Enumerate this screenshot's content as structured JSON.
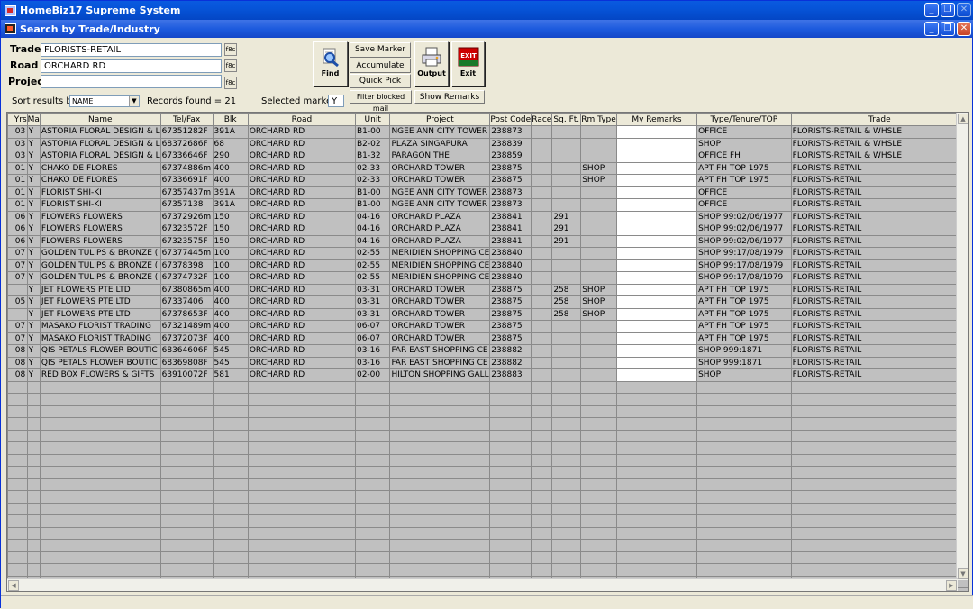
{
  "app_title": "HomeBiz17 Supreme System",
  "window_title": "Search by Trade/Industry",
  "form": {
    "trade_label": "Trade",
    "trade_value": "FLORISTS-RETAIL",
    "road_label": "Road",
    "road_value": "ORCHARD RD",
    "project_label": "Project",
    "project_value": "",
    "lookup_button": "f8c",
    "sort_label": "Sort results by",
    "sort_value": "NAME",
    "records_found": "Records found = 21",
    "selected_marker_label": "Selected marker=",
    "selected_marker_value": "Y"
  },
  "toolbar": {
    "find_label": "Find",
    "save_marker_label": "Save Marker",
    "accumulate_label": "Accumulate",
    "quick_pick_label": "Quick Pick",
    "filter_blocked_label": "Filter blocked mail",
    "show_remarks_label": "Show Remarks",
    "output_label": "Output",
    "exit_label": "Exit",
    "exit_icon_text": "EXIT"
  },
  "grid": {
    "columns": [
      "Yrs",
      "Ma",
      "Name",
      "Tel/Fax",
      "Blk",
      "Road",
      "Unit",
      "Project",
      "Post Code",
      "Race",
      "Sq. Ft.",
      "Rm Type",
      "My Remarks",
      "Type/Tenure/TOP",
      "Trade"
    ],
    "rows": [
      [
        "03",
        "Y",
        "ASTORIA FLORAL DESIGN & L",
        "67351282F",
        "391A",
        "ORCHARD RD",
        "B1-00",
        "NGEE ANN CITY TOWER",
        "238873",
        "",
        "",
        "",
        "",
        "OFFICE",
        "FLORISTS-RETAIL & WHSLE"
      ],
      [
        "03",
        "Y",
        "ASTORIA FLORAL DESIGN & L",
        "68372686F",
        "68",
        "ORCHARD RD",
        "B2-02",
        "PLAZA SINGAPURA",
        "238839",
        "",
        "",
        "",
        "",
        "SHOP",
        "FLORISTS-RETAIL & WHSLE"
      ],
      [
        "03",
        "Y",
        "ASTORIA FLORAL DESIGN & L",
        "67336646F",
        "290",
        "ORCHARD RD",
        "B1-32",
        "PARAGON THE",
        "238859",
        "",
        "",
        "",
        "",
        "OFFICE FH",
        "FLORISTS-RETAIL & WHSLE"
      ],
      [
        "01",
        "Y",
        "CHAKO DE FLORES",
        "67374886m",
        "400",
        "ORCHARD RD",
        "02-33",
        "ORCHARD TOWER",
        "238875",
        "",
        "",
        "SHOP",
        "",
        "APT FH TOP 1975",
        "FLORISTS-RETAIL"
      ],
      [
        "01",
        "Y",
        "CHAKO DE FLORES",
        "67336691F",
        "400",
        "ORCHARD RD",
        "02-33",
        "ORCHARD TOWER",
        "238875",
        "",
        "",
        "SHOP",
        "",
        "APT FH TOP 1975",
        "FLORISTS-RETAIL"
      ],
      [
        "01",
        "Y",
        "FLORIST SHI-KI",
        "67357437m",
        "391A",
        "ORCHARD RD",
        "B1-00",
        "NGEE ANN CITY TOWER",
        "238873",
        "",
        "",
        "",
        "",
        "OFFICE",
        "FLORISTS-RETAIL"
      ],
      [
        "01",
        "Y",
        "FLORIST SHI-KI",
        "67357138",
        "391A",
        "ORCHARD RD",
        "B1-00",
        "NGEE ANN CITY TOWER",
        "238873",
        "",
        "",
        "",
        "",
        "OFFICE",
        "FLORISTS-RETAIL"
      ],
      [
        "06",
        "Y",
        "FLOWERS FLOWERS",
        "67372926m",
        "150",
        "ORCHARD RD",
        "04-16",
        "ORCHARD PLAZA",
        "238841",
        "",
        "291",
        "",
        "",
        "SHOP 99:02/06/1977",
        "FLORISTS-RETAIL"
      ],
      [
        "06",
        "Y",
        "FLOWERS FLOWERS",
        "67323572F",
        "150",
        "ORCHARD RD",
        "04-16",
        "ORCHARD PLAZA",
        "238841",
        "",
        "291",
        "",
        "",
        "SHOP 99:02/06/1977",
        "FLORISTS-RETAIL"
      ],
      [
        "06",
        "Y",
        "FLOWERS FLOWERS",
        "67323575F",
        "150",
        "ORCHARD RD",
        "04-16",
        "ORCHARD PLAZA",
        "238841",
        "",
        "291",
        "",
        "",
        "SHOP 99:02/06/1977",
        "FLORISTS-RETAIL"
      ],
      [
        "07",
        "Y",
        "GOLDEN TULIPS & BRONZE (",
        "67377445m",
        "100",
        "ORCHARD RD",
        "02-55",
        "MERIDIEN SHOPPING CE",
        "238840",
        "",
        "",
        "",
        "",
        "SHOP 99:17/08/1979",
        "FLORISTS-RETAIL"
      ],
      [
        "07",
        "Y",
        "GOLDEN TULIPS & BRONZE (",
        "67378398",
        "100",
        "ORCHARD RD",
        "02-55",
        "MERIDIEN SHOPPING CE",
        "238840",
        "",
        "",
        "",
        "",
        "SHOP 99:17/08/1979",
        "FLORISTS-RETAIL"
      ],
      [
        "07",
        "Y",
        "GOLDEN TULIPS & BRONZE (",
        "67374732F",
        "100",
        "ORCHARD RD",
        "02-55",
        "MERIDIEN SHOPPING CE",
        "238840",
        "",
        "",
        "",
        "",
        "SHOP 99:17/08/1979",
        "FLORISTS-RETAIL"
      ],
      [
        "",
        "Y",
        "JET FLOWERS PTE LTD",
        "67380865m",
        "400",
        "ORCHARD RD",
        "03-31",
        "ORCHARD TOWER",
        "238875",
        "",
        "258",
        "SHOP",
        "",
        "APT FH TOP 1975",
        "FLORISTS-RETAIL"
      ],
      [
        "05",
        "Y",
        "JET FLOWERS PTE LTD",
        "67337406",
        "400",
        "ORCHARD RD",
        "03-31",
        "ORCHARD TOWER",
        "238875",
        "",
        "258",
        "SHOP",
        "",
        "APT FH TOP 1975",
        "FLORISTS-RETAIL"
      ],
      [
        "",
        "Y",
        "JET FLOWERS PTE LTD",
        "67378653F",
        "400",
        "ORCHARD RD",
        "03-31",
        "ORCHARD TOWER",
        "238875",
        "",
        "258",
        "SHOP",
        "",
        "APT FH TOP 1975",
        "FLORISTS-RETAIL"
      ],
      [
        "07",
        "Y",
        "MASAKO FLORIST TRADING",
        "67321489m",
        "400",
        "ORCHARD RD",
        "06-07",
        "ORCHARD TOWER",
        "238875",
        "",
        "",
        "",
        "",
        "APT FH TOP 1975",
        "FLORISTS-RETAIL"
      ],
      [
        "07",
        "Y",
        "MASAKO FLORIST TRADING",
        "67372073F",
        "400",
        "ORCHARD RD",
        "06-07",
        "ORCHARD TOWER",
        "238875",
        "",
        "",
        "",
        "",
        "APT FH TOP 1975",
        "FLORISTS-RETAIL"
      ],
      [
        "08",
        "Y",
        "QIS PETALS FLOWER BOUTIC",
        "68364606F",
        "545",
        "ORCHARD RD",
        "03-16",
        "FAR EAST SHOPPING CE",
        "238882",
        "",
        "",
        "",
        "",
        "SHOP 999:1871",
        "FLORISTS-RETAIL"
      ],
      [
        "08",
        "Y",
        "QIS PETALS FLOWER BOUTIC",
        "68369808F",
        "545",
        "ORCHARD RD",
        "03-16",
        "FAR EAST SHOPPING CE",
        "238882",
        "",
        "",
        "",
        "",
        "SHOP 999:1871",
        "FLORISTS-RETAIL"
      ],
      [
        "08",
        "Y",
        "RED BOX FLOWERS & GIFTS",
        "63910072F",
        "581",
        "ORCHARD RD",
        "02-00",
        "HILTON SHOPPING GALL",
        "238883",
        "",
        "",
        "",
        "",
        "SHOP",
        "FLORISTS-RETAIL"
      ]
    ],
    "empty_rows": 17
  }
}
